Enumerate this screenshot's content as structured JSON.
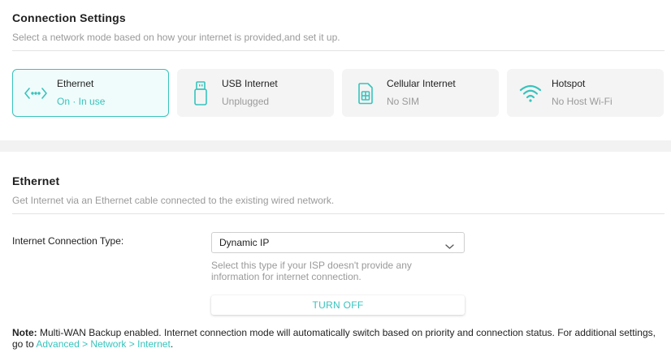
{
  "connection_settings": {
    "title": "Connection Settings",
    "description": "Select a network mode based on how your internet is provided,and set it up."
  },
  "modes": [
    {
      "name": "Ethernet",
      "status": "On · In use",
      "icon": "ethernet-icon",
      "selected": true
    },
    {
      "name": "USB Internet",
      "status": "Unplugged",
      "icon": "usb-icon",
      "selected": false
    },
    {
      "name": "Cellular Internet",
      "status": "No SIM",
      "icon": "sim-card-icon",
      "selected": false
    },
    {
      "name": "Hotspot",
      "status": "No Host Wi-Fi",
      "icon": "wifi-icon",
      "selected": false
    }
  ],
  "ethernet": {
    "title": "Ethernet",
    "description": "Get Internet via an Ethernet cable connected to the existing wired network.",
    "connection_type_label": "Internet Connection Type:",
    "connection_type_value": "Dynamic IP",
    "connection_type_hint": "Select this type if your ISP doesn't provide any information for internet connection.",
    "turn_off_label": "TURN OFF"
  },
  "note": {
    "prefix": "Note:",
    "text": " Multi-WAN Backup enabled. Internet connection mode will automatically switch based on priority and connection status. For additional settings, go to ",
    "link": "Advanced > Network > Internet",
    "suffix": "."
  },
  "colors": {
    "accent": "#37c3bd",
    "muted_text": "#9a9a9a",
    "card_bg": "#f4f4f4",
    "active_card_bg": "#f0fcfb"
  }
}
